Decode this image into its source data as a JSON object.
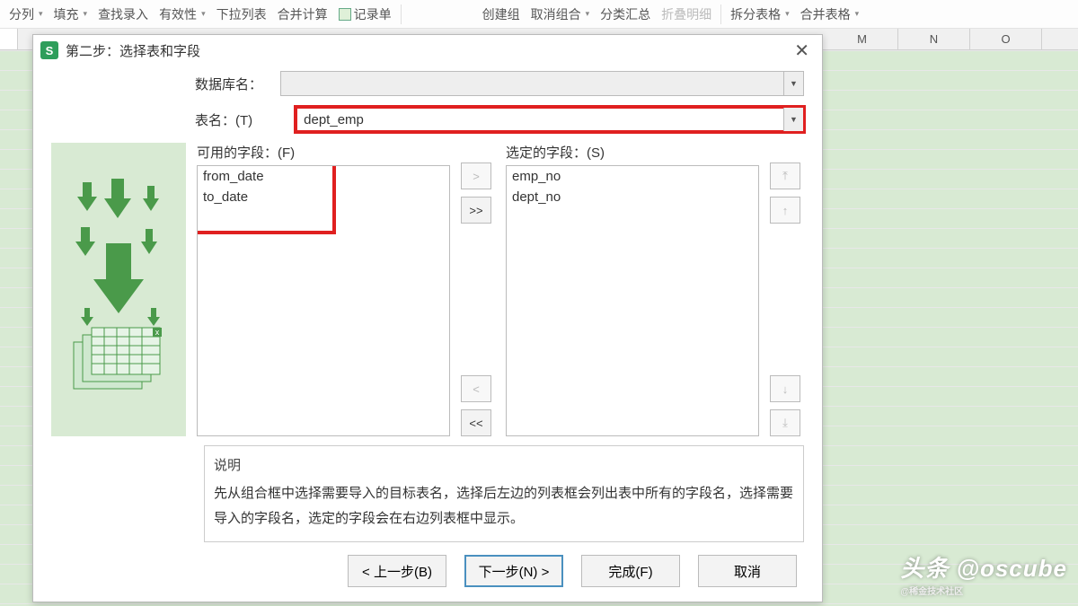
{
  "ribbon": {
    "items": [
      {
        "label": "分列",
        "arrow": true
      },
      {
        "label": "填充",
        "arrow": true
      },
      {
        "label": "查找录入",
        "arrow": false
      },
      {
        "label": "有效性",
        "arrow": true
      },
      {
        "label": "下拉列表",
        "arrow": false
      },
      {
        "label": "合并计算",
        "arrow": false
      },
      {
        "label": "记录单",
        "arrow": false,
        "icon": true
      }
    ],
    "group2": [
      {
        "label": "创建组",
        "arrow": false
      },
      {
        "label": "取消组合",
        "arrow": true
      },
      {
        "label": "分类汇总",
        "arrow": false
      },
      {
        "label": "折叠明细",
        "arrow": false,
        "disabled": true
      }
    ],
    "group3": [
      {
        "label": "拆分表格",
        "arrow": true
      },
      {
        "label": "合并表格",
        "arrow": true
      }
    ]
  },
  "columns": [
    "",
    "",
    "",
    "",
    "",
    "",
    "",
    "",
    "",
    "",
    "",
    "M",
    "N",
    "O"
  ],
  "dialog": {
    "title": "第二步：选择表和字段",
    "db_label": "数据库名：",
    "db_value": "",
    "table_label": "表名：(T)",
    "table_value": "dept_emp",
    "available_label": "可用的字段：(F)",
    "available_items": [
      "from_date",
      "to_date"
    ],
    "selected_label": "选定的字段：(S)",
    "selected_items": [
      "emp_no",
      "dept_no"
    ],
    "move": {
      "add": ">",
      "addall": ">>",
      "remove": "<",
      "removeall": "<<"
    },
    "reorder": {
      "top": "⤒",
      "up": "↑",
      "down": "↓",
      "bottom": "⤓"
    },
    "desc_label": "说明",
    "desc_text": "先从组合框中选择需要导入的目标表名，选择后左边的列表框会列出表中所有的字段名，选择需要导入的字段名，选定的字段会在右边列表框中显示。",
    "buttons": {
      "prev": "< 上一步(B)",
      "next": "下一步(N) >",
      "finish": "完成(F)",
      "cancel": "取消"
    }
  },
  "watermark": {
    "main": "头条 @oscube",
    "sub": "@稀金技术社区"
  }
}
